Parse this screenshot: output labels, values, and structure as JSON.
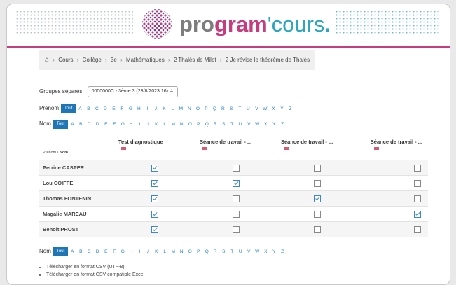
{
  "brand": {
    "part1": "pro",
    "part2": "gram",
    "part3": "'cours",
    "part4": "."
  },
  "breadcrumb": [
    "Cours",
    "Collège",
    "3e",
    "Mathématiques",
    "2 Thalès de Milet",
    "2 Je révise le théorème de Thalès"
  ],
  "group": {
    "label": "Groupes séparés",
    "selected": "0000000C - 3ème 3 (23/8/2023 16) ≑"
  },
  "filters": {
    "prenom_label": "Prénom",
    "nom_label": "Nom",
    "all_label": "Tout",
    "letters": [
      "A",
      "B",
      "C",
      "D",
      "E",
      "F",
      "G",
      "H",
      "I",
      "J",
      "K",
      "L",
      "M",
      "N",
      "O",
      "P",
      "Q",
      "R",
      "S",
      "T",
      "U",
      "V",
      "W",
      "X",
      "Y",
      "Z"
    ]
  },
  "table": {
    "first_header_prefix": "Prénom / ",
    "first_header_bold": "Nom",
    "columns": [
      "Test diagnostique",
      "Séance de travail - ...",
      "Séance de travail - ...",
      "Séance de travail - ..."
    ],
    "rows": [
      {
        "name": "Perrine CASPER",
        "checks": [
          true,
          false,
          false,
          false
        ]
      },
      {
        "name": "Lou COIFFE",
        "checks": [
          true,
          true,
          false,
          false
        ]
      },
      {
        "name": "Thomas FONTENIN",
        "checks": [
          true,
          false,
          true,
          false
        ]
      },
      {
        "name": "Magalie MAREAU",
        "checks": [
          true,
          false,
          false,
          true
        ]
      },
      {
        "name": "Benoît PROST",
        "checks": [
          true,
          false,
          false,
          false
        ]
      }
    ]
  },
  "downloads": [
    "Télécharger en format CSV (UTF-8)",
    "Télécharger en format CSV compatible Excel"
  ],
  "colors": {
    "accent": "#1f76b6",
    "brand_pink": "#c53d7e",
    "brand_teal": "#2aa7bf"
  },
  "icons": {
    "home": "home-icon",
    "flag": "flag-icon"
  }
}
